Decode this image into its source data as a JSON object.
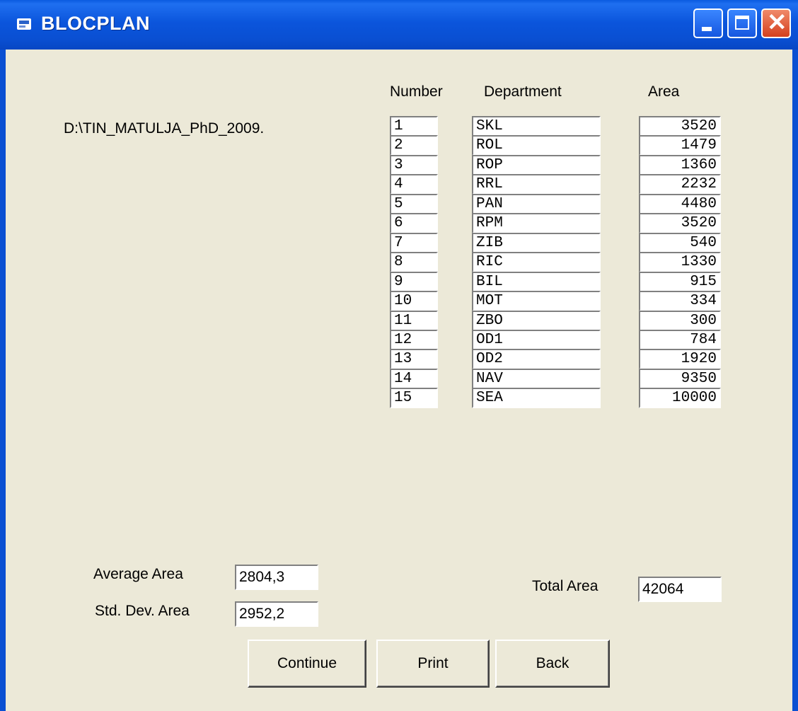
{
  "window": {
    "title": "BLOCPLAN",
    "icon": "window-icon",
    "controls": [
      "minimize",
      "maximize",
      "close"
    ],
    "close_glyph": "✕"
  },
  "file_path": "D:\\TIN_MATULJA_PhD_2009.",
  "headers": {
    "number": "Number",
    "department": "Department",
    "area": "Area"
  },
  "rows": [
    {
      "number": "1",
      "department": "SKL",
      "area": "3520"
    },
    {
      "number": "2",
      "department": "ROL",
      "area": "1479"
    },
    {
      "number": "3",
      "department": "ROP",
      "area": "1360"
    },
    {
      "number": "4",
      "department": "RRL",
      "area": "2232"
    },
    {
      "number": "5",
      "department": "PAN",
      "area": "4480"
    },
    {
      "number": "6",
      "department": "RPM",
      "area": "3520"
    },
    {
      "number": "7",
      "department": "ZIB",
      "area": "540"
    },
    {
      "number": "8",
      "department": "RIC",
      "area": "1330"
    },
    {
      "number": "9",
      "department": "BIL",
      "area": "915"
    },
    {
      "number": "10",
      "department": "MOT",
      "area": "334"
    },
    {
      "number": "11",
      "department": "ZBO",
      "area": "300"
    },
    {
      "number": "12",
      "department": "OD1",
      "area": "784"
    },
    {
      "number": "13",
      "department": "OD2",
      "area": "1920"
    },
    {
      "number": "14",
      "department": "NAV",
      "area": "9350"
    },
    {
      "number": "15",
      "department": "SEA",
      "area": "10000"
    }
  ],
  "stats": {
    "average_label": "Average Area",
    "average_value": "2804,3",
    "stddev_label": "Std. Dev. Area",
    "stddev_value": "2952,2",
    "total_label": "Total Area",
    "total_value": "42064"
  },
  "buttons": {
    "continue": "Continue",
    "print": "Print",
    "back": "Back"
  },
  "colors": {
    "titlebar": "#0A4FD2",
    "face": "#ECE9D8",
    "close": "#D4401E"
  }
}
